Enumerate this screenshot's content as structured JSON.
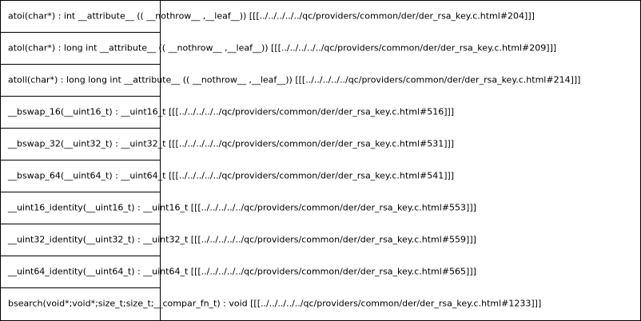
{
  "functions": [
    {
      "signature": "atoi(char*) :  int  __attribute__ (( __nothrow__ ,__leaf__)) [[[../../../../../qc/providers/common/der/der_rsa_key.c.html#204]]]"
    },
    {
      "signature": "atol(char*) :  long  int  __attribute__ (( __nothrow__ ,__leaf__)) [[[../../../../../qc/providers/common/der/der_rsa_key.c.html#209]]]"
    },
    {
      "signature": "atoll(char*) :  long  long  int  __attribute__ (( __nothrow__ ,__leaf__)) [[[../../../../../qc/providers/common/der/der_rsa_key.c.html#214]]]"
    },
    {
      "signature": "__bswap_16(__uint16_t) : __uint16_t  [[[../../../../../qc/providers/common/der/der_rsa_key.c.html#516]]]"
    },
    {
      "signature": "__bswap_32(__uint32_t) : __uint32_t  [[[../../../../../qc/providers/common/der/der_rsa_key.c.html#531]]]"
    },
    {
      "signature": "__bswap_64(__uint64_t) : __uint64_t  [[[../../../../../qc/providers/common/der/der_rsa_key.c.html#541]]]"
    },
    {
      "signature": "__uint16_identity(__uint16_t) : __uint16_t  [[[../../../../../qc/providers/common/der/der_rsa_key.c.html#553]]]"
    },
    {
      "signature": "__uint32_identity(__uint32_t) : __uint32_t  [[[../../../../../qc/providers/common/der/der_rsa_key.c.html#559]]]"
    },
    {
      "signature": "__uint64_identity(__uint64_t) : __uint64_t  [[[../../../../../qc/providers/common/der/der_rsa_key.c.html#565]]]"
    },
    {
      "signature": "bsearch(void*;void*;size_t;size_t;__compar_fn_t) :  void  [[[../../../../../qc/providers/common/der/der_rsa_key.c.html#1233]]]"
    }
  ]
}
